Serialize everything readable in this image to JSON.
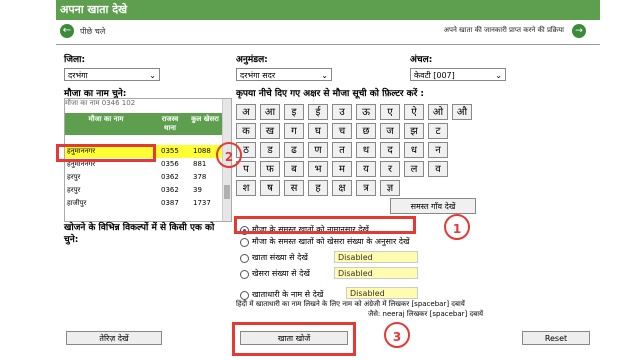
{
  "header": {
    "title": "अपना खाता देखे"
  },
  "topbar": {
    "back_label": "पीछे चले",
    "help_link": "अपने खाता की जानकारी प्राप्त करने की प्रक्रिया"
  },
  "filters": {
    "district": {
      "label": "जिला:",
      "value": "दरभंगा"
    },
    "subdivision": {
      "label": "अनुमंडल:",
      "value": "दरभंगा सदर"
    },
    "circle": {
      "label": "अंचल:",
      "value": "केवटी [007]"
    }
  },
  "mouza": {
    "label": "मौजा का नाम चुने:",
    "ghost_row": "मौजा का नाम   0346  102",
    "headers": [
      "मौजा का नाम",
      "राजस्व थाना",
      "कुल खेसरा"
    ],
    "rows": [
      [
        "हनुमाननगर",
        "0355",
        "1088"
      ],
      [
        "हनुमाननगर",
        "0356",
        "881"
      ],
      [
        "हरपुर",
        "0362",
        "378"
      ],
      [
        "हरपुर",
        "0362",
        "39"
      ],
      [
        "हाजीपुर",
        "0387",
        "1737"
      ]
    ]
  },
  "keyboard": {
    "title": "कृपया नीचे दिए गए अक्षर से मौजा सूची को फ़िल्टर करें :",
    "rows": [
      [
        "अ",
        "आ",
        "इ",
        "ई",
        "उ",
        "ऊ",
        "ए",
        "ऐ",
        "ओ",
        "औ"
      ],
      [
        "क",
        "ख",
        "ग",
        "घ",
        "च",
        "छ",
        "ज",
        "झ",
        "ट"
      ],
      [
        "ठ",
        "ड",
        "ढ",
        "ण",
        "त",
        "थ",
        "द",
        "ध",
        "न"
      ],
      [
        "प",
        "फ",
        "ब",
        "भ",
        "म",
        "य",
        "र",
        "ल",
        "व"
      ],
      [
        "श",
        "ष",
        "स",
        "ह",
        "क्ष",
        "त्र",
        "ज्ञ"
      ]
    ],
    "all_label": "समस्त गाँव देखें"
  },
  "search": {
    "label": "खोजने के विभिन्न विकल्पों में से किसी एक को चुने:",
    "options": [
      "मौजा के समस्त खातों को नामानुसार देखें",
      "मौजा के समस्त खातों को खेसरा संख्या के अनुसार देखें",
      "खाता संख्या से देखें",
      "खेसरा संख्या से देखें",
      "खाताधारी के नाम से देखें"
    ],
    "disabled_text": "Disabled",
    "note_1": "हिंदी में खाताधारी का नाम लिखने के लिए नाम को अंग्रेजी में लिखकर [spacebar] दबायें",
    "note_2": "जैसे: neeraj लिखकर [spacebar] दबायें"
  },
  "buttons": {
    "register": "तेरिज़ देखें",
    "search": "खाता खोजें",
    "reset": "Reset"
  },
  "callouts": [
    "1",
    "2",
    "3"
  ],
  "colors": {
    "header_green": "#5e9e4f",
    "highlight_red": "#e53935",
    "selected_yellow": "#ffff33"
  }
}
